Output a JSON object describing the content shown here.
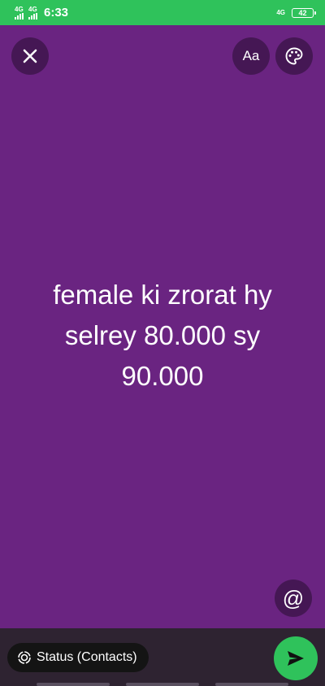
{
  "status_bar": {
    "sim1_network": "4G",
    "sim2_network": "4G",
    "time": "6:33",
    "data_network": "4G",
    "battery": "42"
  },
  "icons": {
    "close": "close-icon",
    "text_style": "text-style-icon",
    "palette": "palette-icon",
    "mention": "at-icon",
    "audience": "status-audience-icon",
    "send": "send-icon"
  },
  "toolbar": {
    "text_style_label": "Aa"
  },
  "status_text": {
    "lines": [
      "female ki zrorat hy",
      "selrey 80.000 sy",
      "90.000"
    ]
  },
  "mention_label": "@",
  "footer": {
    "audience_label": "Status (Contacts)"
  },
  "colors": {
    "background": "#6a2481",
    "status_bar": "#2fc25b",
    "send_button": "#2fc25b",
    "bottom_bar": "#2e2331"
  }
}
